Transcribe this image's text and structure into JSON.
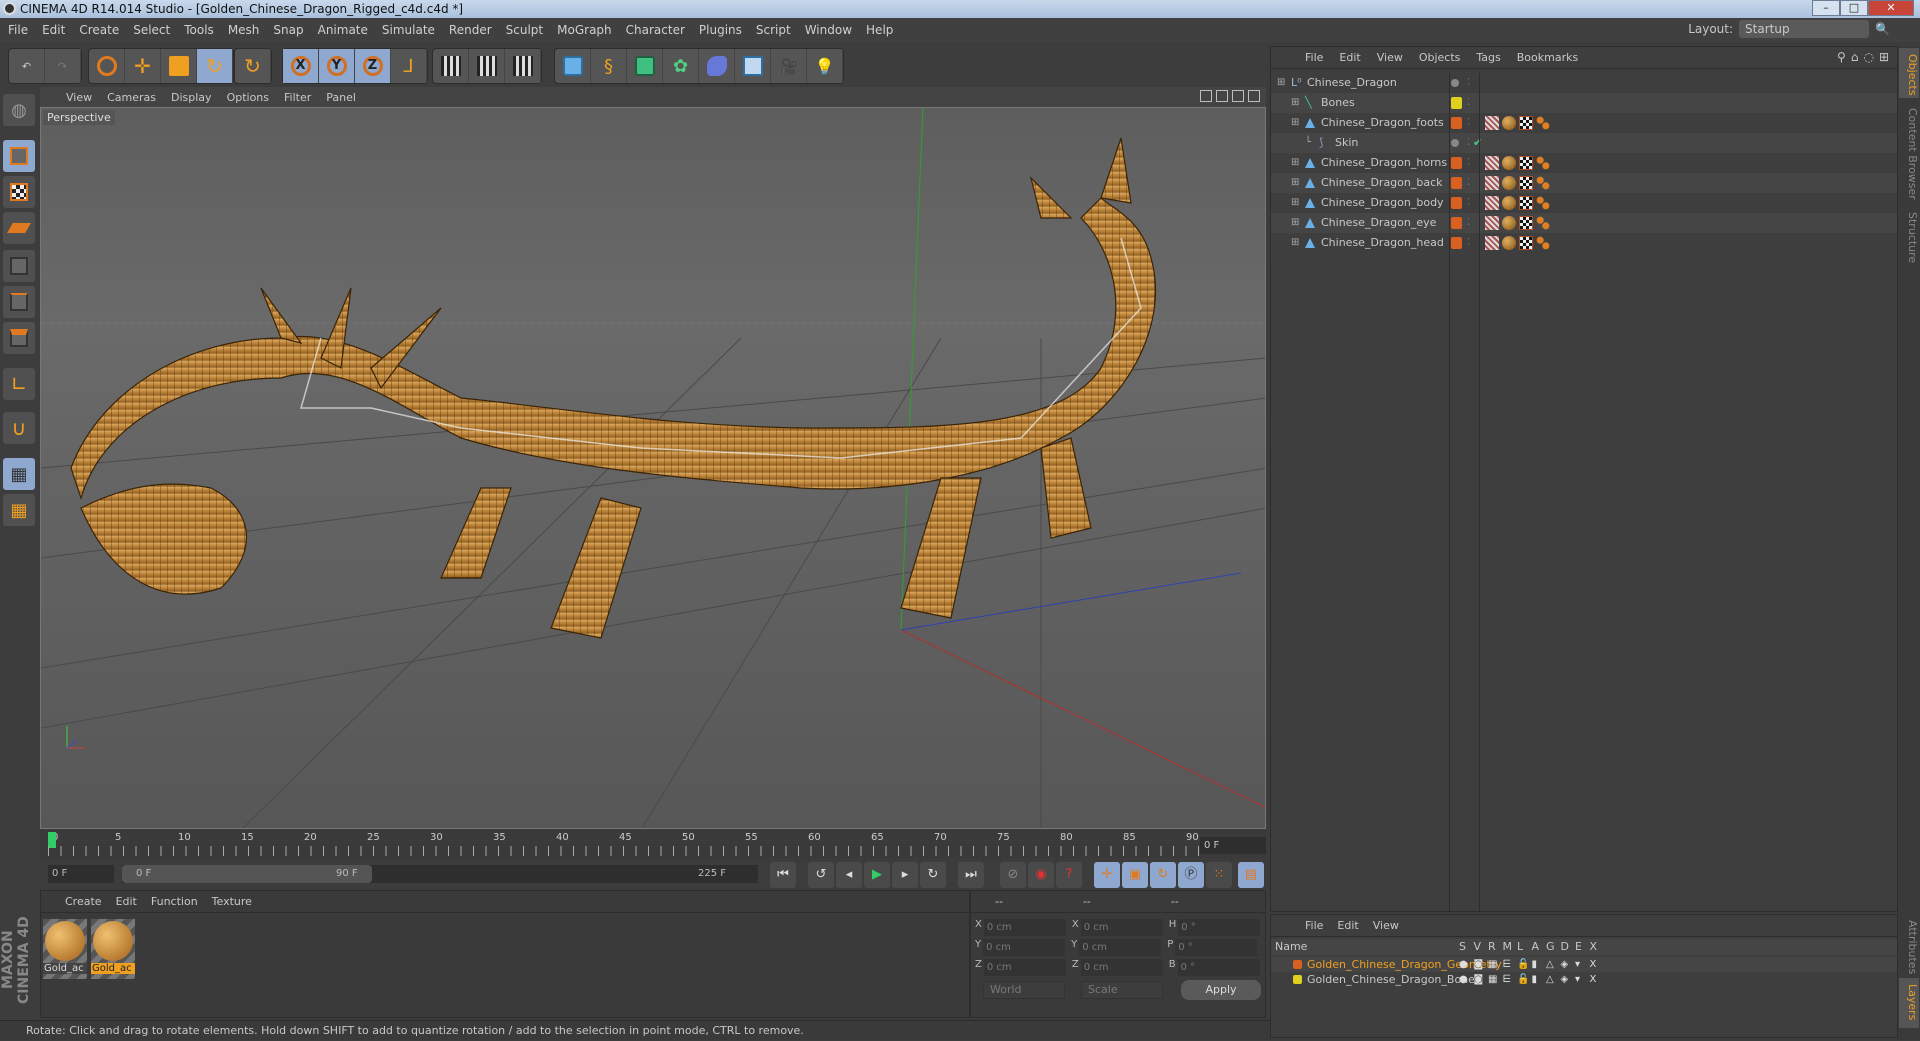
{
  "window": {
    "title": "CINEMA 4D R14.014 Studio - [Golden_Chinese_Dragon_Rigged_c4d.c4d *]"
  },
  "menu": [
    "File",
    "Edit",
    "Create",
    "Select",
    "Tools",
    "Mesh",
    "Snap",
    "Animate",
    "Simulate",
    "Render",
    "Sculpt",
    "MoGraph",
    "Character",
    "Plugins",
    "Script",
    "Window",
    "Help"
  ],
  "layout": {
    "label": "Layout:",
    "value": "Startup"
  },
  "toolbar": {
    "axes": [
      "X",
      "Y",
      "Z"
    ]
  },
  "viewport": {
    "menu": [
      "View",
      "Cameras",
      "Display",
      "Options",
      "Filter",
      "Panel"
    ],
    "label": "Perspective"
  },
  "timeline": {
    "ticks": [
      "0",
      "5",
      "10",
      "15",
      "20",
      "25",
      "30",
      "35",
      "40",
      "45",
      "50",
      "55",
      "60",
      "65",
      "70",
      "75",
      "80",
      "85",
      "90"
    ],
    "current_frame": "0 F",
    "start": "0 F",
    "range_start": "0 F",
    "range_end": "90 F",
    "end": "225 F",
    "playhead_frame": 0
  },
  "materials": {
    "menu": [
      "Create",
      "Edit",
      "Function",
      "Texture"
    ],
    "items": [
      {
        "label": "Gold_ac",
        "selected": false
      },
      {
        "label": "Gold_ac",
        "selected": true
      }
    ]
  },
  "coords": {
    "headers": [
      "--",
      "--",
      "--"
    ],
    "rows": [
      {
        "a": "X",
        "av": "0 cm",
        "b": "X",
        "bv": "0 cm",
        "c": "H",
        "cv": "0 °"
      },
      {
        "a": "Y",
        "av": "0 cm",
        "b": "Y",
        "bv": "0 cm",
        "c": "P",
        "cv": "0 °"
      },
      {
        "a": "Z",
        "av": "0 cm",
        "b": "Z",
        "bv": "0 cm",
        "c": "B",
        "cv": "0 °"
      }
    ],
    "world": "World",
    "scale": "Scale",
    "apply": "Apply"
  },
  "status": "Rotate: Click and drag to rotate elements. Hold down SHIFT to add to quantize rotation / add to the selection in point mode, CTRL to remove.",
  "brand": "MAXON CINEMA 4D",
  "objects": {
    "menu": [
      "File",
      "Edit",
      "View",
      "Objects",
      "Tags",
      "Bookmarks"
    ],
    "rows": [
      {
        "name": "Chinese_Dragon",
        "indent": 0,
        "color": "#888888",
        "tags": false
      },
      {
        "name": "Bones",
        "indent": 1,
        "color": "#e0d020",
        "tags": false
      },
      {
        "name": "Chinese_Dragon_foots",
        "indent": 1,
        "color": "#d86020",
        "tags": true
      },
      {
        "name": "Skin",
        "indent": 2,
        "color": "#888888",
        "tags": false
      },
      {
        "name": "Chinese_Dragon_horns",
        "indent": 1,
        "color": "#d86020",
        "tags": true
      },
      {
        "name": "Chinese_Dragon_back",
        "indent": 1,
        "color": "#d86020",
        "tags": true
      },
      {
        "name": "Chinese_Dragon_body",
        "indent": 1,
        "color": "#d86020",
        "tags": true
      },
      {
        "name": "Chinese_Dragon_eye",
        "indent": 1,
        "color": "#d86020",
        "tags": true
      },
      {
        "name": "Chinese_Dragon_head",
        "indent": 1,
        "color": "#d86020",
        "tags": true
      }
    ]
  },
  "side_tabs": [
    "Objects",
    "Content Browser",
    "Structure",
    "Attributes",
    "Layers"
  ],
  "layers": {
    "menu": [
      "File",
      "Edit",
      "View"
    ],
    "columns": [
      "Name",
      "S",
      "V",
      "R",
      "M",
      "L",
      "A",
      "G",
      "D",
      "E",
      "X"
    ],
    "rows": [
      {
        "name": "Golden_Chinese_Dragon_Geometry",
        "color": "#d86020",
        "selected": true
      },
      {
        "name": "Golden_Chinese_Dragon_Bones",
        "color": "#e0d020",
        "selected": false
      }
    ]
  }
}
